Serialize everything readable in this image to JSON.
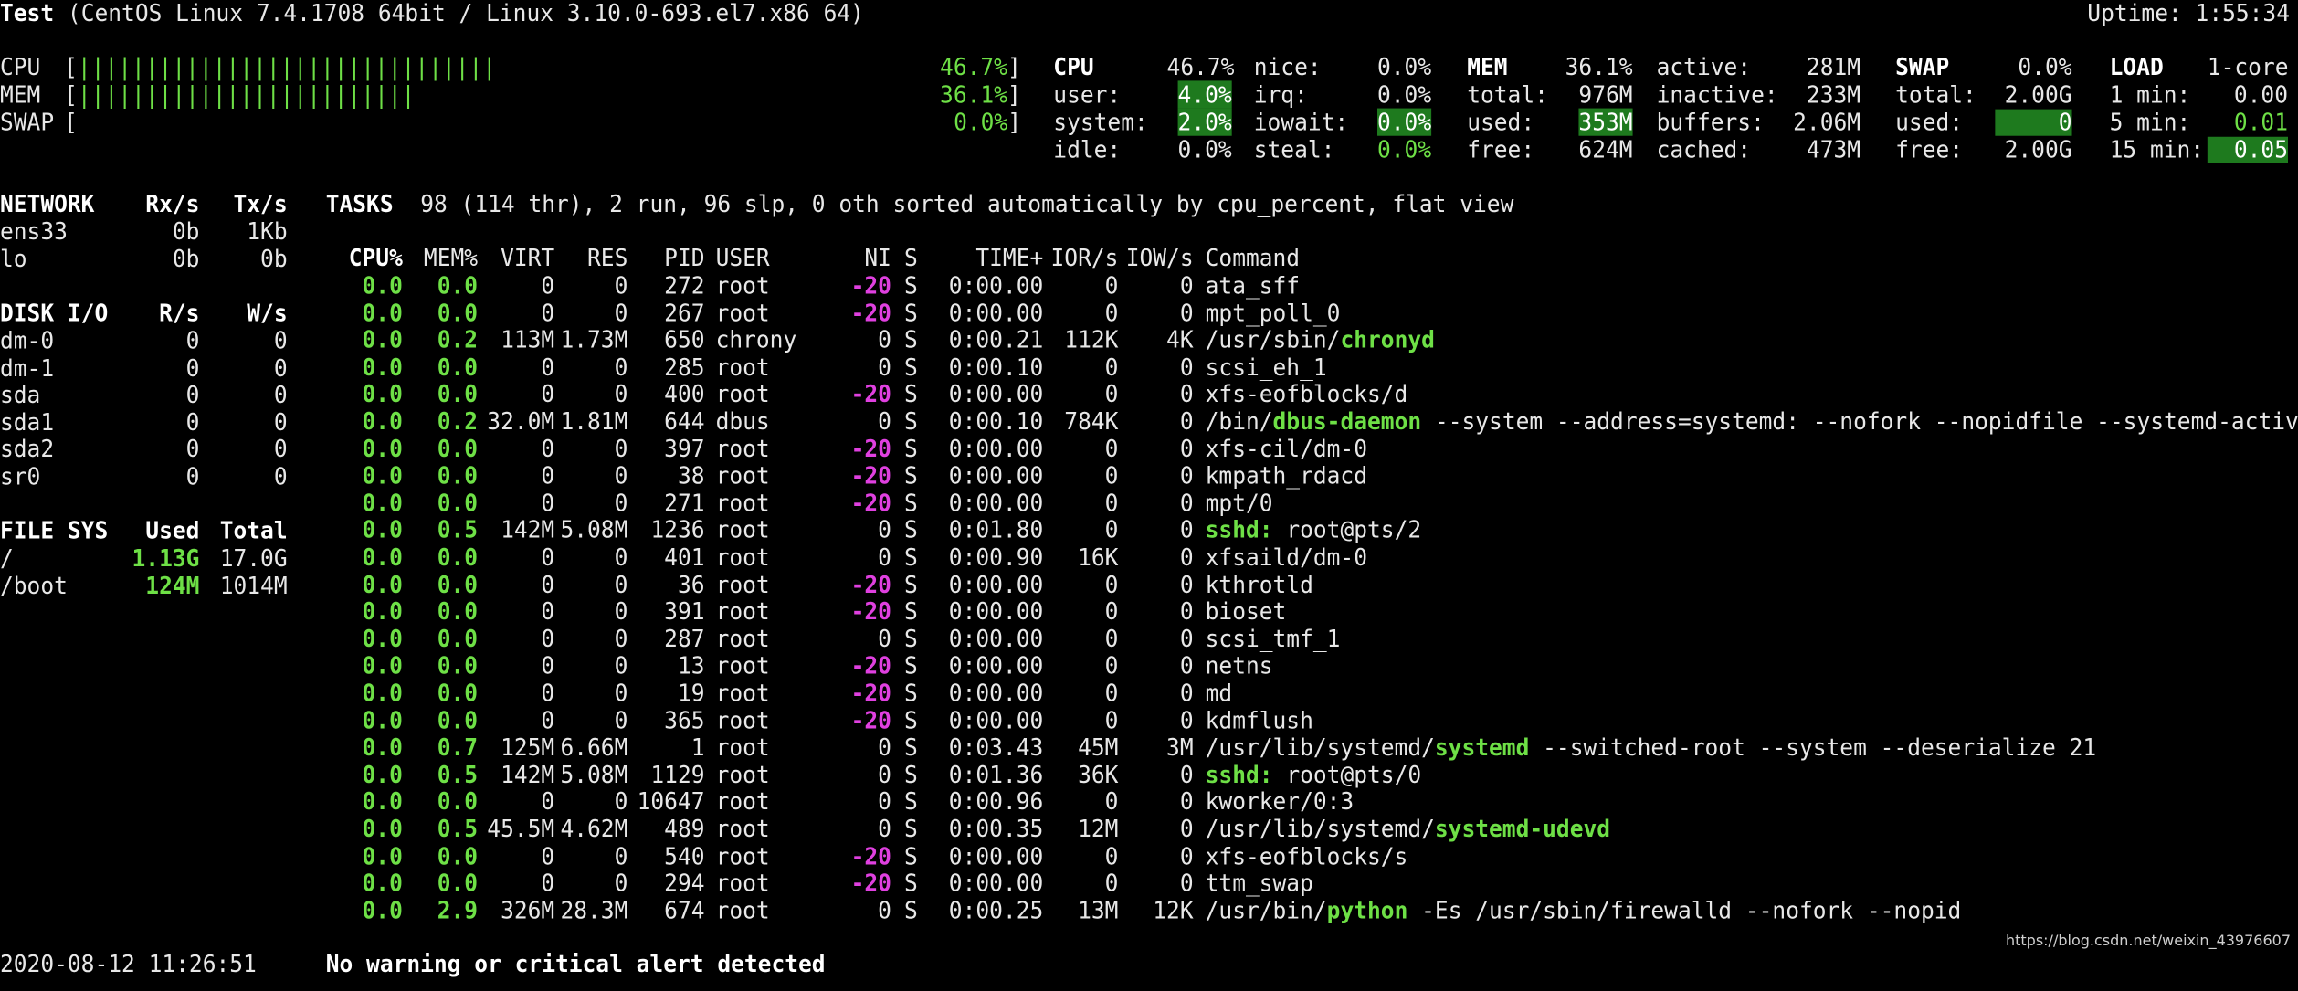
{
  "header": {
    "hostname": "Test",
    "system": "(CentOS Linux 7.4.1708 64bit / Linux 3.10.0-693.el7.x86_64)",
    "uptime": "Uptime: 1:55:34"
  },
  "quicklook": {
    "cpu": {
      "label": "CPU",
      "bar": "|||||||||||||||||||||||||||||||",
      "value": "46.7%"
    },
    "mem": {
      "label": "MEM",
      "bar": "|||||||||||||||||||||||||",
      "value": "36.1%"
    },
    "swap": {
      "label": "SWAP",
      "bar": "",
      "value": "0.0%"
    }
  },
  "cpu": {
    "title": "CPU",
    "total": "46.7%",
    "user_label": "user:",
    "user": "4.0%",
    "system_label": "system:",
    "system": "2.0%",
    "idle_label": "idle:",
    "idle": "0.0%",
    "nice_label": "nice:",
    "nice": "0.0%",
    "irq_label": "irq:",
    "irq": "0.0%",
    "iowait_label": "iowait:",
    "iowait": "0.0%",
    "steal_label": "steal:",
    "steal": "0.0%"
  },
  "mem": {
    "title": "MEM",
    "percent": "36.1%",
    "total_label": "total:",
    "total": "976M",
    "used_label": "used:",
    "used": "353M",
    "free_label": "free:",
    "free": "624M",
    "active_label": "active:",
    "active": "281M",
    "inactive_label": "inactive:",
    "inactive": "233M",
    "buffers_label": "buffers:",
    "buffers": "2.06M",
    "cached_label": "cached:",
    "cached": "473M"
  },
  "swap": {
    "title": "SWAP",
    "percent": "0.0%",
    "total_label": "total:",
    "total": "2.00G",
    "used_label": "used:",
    "used": "0",
    "free_label": "free:",
    "free": "2.00G"
  },
  "load": {
    "title": "LOAD",
    "cores": "1-core",
    "m1_label": "1 min:",
    "m1": "0.00",
    "m5_label": "5 min:",
    "m5": "0.01",
    "m15_label": "15 min:",
    "m15": "0.05"
  },
  "network": {
    "title": "NETWORK",
    "rx_header": "Rx/s",
    "tx_header": "Tx/s",
    "rows": [
      {
        "name": "ens33",
        "rx": "0b",
        "tx": "1Kb"
      },
      {
        "name": "lo",
        "rx": "0b",
        "tx": "0b"
      }
    ]
  },
  "diskio": {
    "title": "DISK I/O",
    "r_header": "R/s",
    "w_header": "W/s",
    "rows": [
      {
        "name": "dm-0",
        "r": "0",
        "w": "0"
      },
      {
        "name": "dm-1",
        "r": "0",
        "w": "0"
      },
      {
        "name": "sda",
        "r": "0",
        "w": "0"
      },
      {
        "name": "sda1",
        "r": "0",
        "w": "0"
      },
      {
        "name": "sda2",
        "r": "0",
        "w": "0"
      },
      {
        "name": "sr0",
        "r": "0",
        "w": "0"
      }
    ]
  },
  "filesys": {
    "title": "FILE SYS",
    "used_header": "Used",
    "total_header": "Total",
    "rows": [
      {
        "name": "/",
        "used": "1.13G",
        "total": "17.0G"
      },
      {
        "name": "/boot",
        "used": "124M",
        "total": "1014M"
      }
    ]
  },
  "tasks": {
    "title": "TASKS",
    "summary": "98 (114 thr), 2 run, 96 slp, 0 oth sorted automatically by cpu_percent, flat view"
  },
  "process_headers": {
    "cpu": "CPU%",
    "mem": "MEM%",
    "virt": "VIRT",
    "res": "RES",
    "pid": "PID",
    "user": "USER",
    "ni": "NI",
    "s": "S",
    "time": "TIME+",
    "ior": "IOR/s",
    "iow": "IOW/s",
    "cmd": "Command"
  },
  "processes": [
    {
      "cpu": "0.0",
      "mem": "0.0",
      "virt": "0",
      "res": "0",
      "pid": "272",
      "user": "root",
      "ni": "-20",
      "s": "S",
      "time": "0:00.00",
      "ior": "0",
      "iow": "0",
      "cmd_prefix": "",
      "cmd_main": "ata_sff",
      "cmd_args": "",
      "main_green": false
    },
    {
      "cpu": "0.0",
      "mem": "0.0",
      "virt": "0",
      "res": "0",
      "pid": "267",
      "user": "root",
      "ni": "-20",
      "s": "S",
      "time": "0:00.00",
      "ior": "0",
      "iow": "0",
      "cmd_prefix": "",
      "cmd_main": "mpt_poll_0",
      "cmd_args": "",
      "main_green": false
    },
    {
      "cpu": "0.0",
      "mem": "0.2",
      "virt": "113M",
      "res": "1.73M",
      "pid": "650",
      "user": "chrony",
      "ni": "0",
      "s": "S",
      "time": "0:00.21",
      "ior": "112K",
      "iow": "4K",
      "cmd_prefix": "/usr/sbin/",
      "cmd_main": "chronyd",
      "cmd_args": "",
      "main_green": true
    },
    {
      "cpu": "0.0",
      "mem": "0.0",
      "virt": "0",
      "res": "0",
      "pid": "285",
      "user": "root",
      "ni": "0",
      "s": "S",
      "time": "0:00.10",
      "ior": "0",
      "iow": "0",
      "cmd_prefix": "",
      "cmd_main": "scsi_eh_1",
      "cmd_args": "",
      "main_green": false
    },
    {
      "cpu": "0.0",
      "mem": "0.0",
      "virt": "0",
      "res": "0",
      "pid": "400",
      "user": "root",
      "ni": "-20",
      "s": "S",
      "time": "0:00.00",
      "ior": "0",
      "iow": "0",
      "cmd_prefix": "",
      "cmd_main": "xfs-eofblocks/d",
      "cmd_args": "",
      "main_green": false
    },
    {
      "cpu": "0.0",
      "mem": "0.2",
      "virt": "32.0M",
      "res": "1.81M",
      "pid": "644",
      "user": "dbus",
      "ni": "0",
      "s": "S",
      "time": "0:00.10",
      "ior": "784K",
      "iow": "0",
      "cmd_prefix": "/bin/",
      "cmd_main": "dbus-daemon",
      "cmd_args": " --system --address=systemd: --nofork --nopidfile --systemd-activation",
      "main_green": true
    },
    {
      "cpu": "0.0",
      "mem": "0.0",
      "virt": "0",
      "res": "0",
      "pid": "397",
      "user": "root",
      "ni": "-20",
      "s": "S",
      "time": "0:00.00",
      "ior": "0",
      "iow": "0",
      "cmd_prefix": "",
      "cmd_main": "xfs-cil/dm-0",
      "cmd_args": "",
      "main_green": false
    },
    {
      "cpu": "0.0",
      "mem": "0.0",
      "virt": "0",
      "res": "0",
      "pid": "38",
      "user": "root",
      "ni": "-20",
      "s": "S",
      "time": "0:00.00",
      "ior": "0",
      "iow": "0",
      "cmd_prefix": "",
      "cmd_main": "kmpath_rdacd",
      "cmd_args": "",
      "main_green": false
    },
    {
      "cpu": "0.0",
      "mem": "0.0",
      "virt": "0",
      "res": "0",
      "pid": "271",
      "user": "root",
      "ni": "-20",
      "s": "S",
      "time": "0:00.00",
      "ior": "0",
      "iow": "0",
      "cmd_prefix": "",
      "cmd_main": "mpt/0",
      "cmd_args": "",
      "main_green": false
    },
    {
      "cpu": "0.0",
      "mem": "0.5",
      "virt": "142M",
      "res": "5.08M",
      "pid": "1236",
      "user": "root",
      "ni": "0",
      "s": "S",
      "time": "0:01.80",
      "ior": "0",
      "iow": "0",
      "cmd_prefix": "",
      "cmd_main": "sshd:",
      "cmd_args": " root@pts/2",
      "main_green": true
    },
    {
      "cpu": "0.0",
      "mem": "0.0",
      "virt": "0",
      "res": "0",
      "pid": "401",
      "user": "root",
      "ni": "0",
      "s": "S",
      "time": "0:00.90",
      "ior": "16K",
      "iow": "0",
      "cmd_prefix": "",
      "cmd_main": "xfsaild/dm-0",
      "cmd_args": "",
      "main_green": false
    },
    {
      "cpu": "0.0",
      "mem": "0.0",
      "virt": "0",
      "res": "0",
      "pid": "36",
      "user": "root",
      "ni": "-20",
      "s": "S",
      "time": "0:00.00",
      "ior": "0",
      "iow": "0",
      "cmd_prefix": "",
      "cmd_main": "kthrotld",
      "cmd_args": "",
      "main_green": false
    },
    {
      "cpu": "0.0",
      "mem": "0.0",
      "virt": "0",
      "res": "0",
      "pid": "391",
      "user": "root",
      "ni": "-20",
      "s": "S",
      "time": "0:00.00",
      "ior": "0",
      "iow": "0",
      "cmd_prefix": "",
      "cmd_main": "bioset",
      "cmd_args": "",
      "main_green": false
    },
    {
      "cpu": "0.0",
      "mem": "0.0",
      "virt": "0",
      "res": "0",
      "pid": "287",
      "user": "root",
      "ni": "0",
      "s": "S",
      "time": "0:00.00",
      "ior": "0",
      "iow": "0",
      "cmd_prefix": "",
      "cmd_main": "scsi_tmf_1",
      "cmd_args": "",
      "main_green": false
    },
    {
      "cpu": "0.0",
      "mem": "0.0",
      "virt": "0",
      "res": "0",
      "pid": "13",
      "user": "root",
      "ni": "-20",
      "s": "S",
      "time": "0:00.00",
      "ior": "0",
      "iow": "0",
      "cmd_prefix": "",
      "cmd_main": "netns",
      "cmd_args": "",
      "main_green": false
    },
    {
      "cpu": "0.0",
      "mem": "0.0",
      "virt": "0",
      "res": "0",
      "pid": "19",
      "user": "root",
      "ni": "-20",
      "s": "S",
      "time": "0:00.00",
      "ior": "0",
      "iow": "0",
      "cmd_prefix": "",
      "cmd_main": "md",
      "cmd_args": "",
      "main_green": false
    },
    {
      "cpu": "0.0",
      "mem": "0.0",
      "virt": "0",
      "res": "0",
      "pid": "365",
      "user": "root",
      "ni": "-20",
      "s": "S",
      "time": "0:00.00",
      "ior": "0",
      "iow": "0",
      "cmd_prefix": "",
      "cmd_main": "kdmflush",
      "cmd_args": "",
      "main_green": false
    },
    {
      "cpu": "0.0",
      "mem": "0.7",
      "virt": "125M",
      "res": "6.66M",
      "pid": "1",
      "user": "root",
      "ni": "0",
      "s": "S",
      "time": "0:03.43",
      "ior": "45M",
      "iow": "3M",
      "cmd_prefix": "/usr/lib/systemd/",
      "cmd_main": "systemd",
      "cmd_args": " --switched-root --system --deserialize 21",
      "main_green": true
    },
    {
      "cpu": "0.0",
      "mem": "0.5",
      "virt": "142M",
      "res": "5.08M",
      "pid": "1129",
      "user": "root",
      "ni": "0",
      "s": "S",
      "time": "0:01.36",
      "ior": "36K",
      "iow": "0",
      "cmd_prefix": "",
      "cmd_main": "sshd:",
      "cmd_args": " root@pts/0",
      "main_green": true
    },
    {
      "cpu": "0.0",
      "mem": "0.0",
      "virt": "0",
      "res": "0",
      "pid": "10647",
      "user": "root",
      "ni": "0",
      "s": "S",
      "time": "0:00.96",
      "ior": "0",
      "iow": "0",
      "cmd_prefix": "",
      "cmd_main": "kworker/0:3",
      "cmd_args": "",
      "main_green": false
    },
    {
      "cpu": "0.0",
      "mem": "0.5",
      "virt": "45.5M",
      "res": "4.62M",
      "pid": "489",
      "user": "root",
      "ni": "0",
      "s": "S",
      "time": "0:00.35",
      "ior": "12M",
      "iow": "0",
      "cmd_prefix": "/usr/lib/systemd/",
      "cmd_main": "systemd-udevd",
      "cmd_args": "",
      "main_green": true
    },
    {
      "cpu": "0.0",
      "mem": "0.0",
      "virt": "0",
      "res": "0",
      "pid": "540",
      "user": "root",
      "ni": "-20",
      "s": "S",
      "time": "0:00.00",
      "ior": "0",
      "iow": "0",
      "cmd_prefix": "",
      "cmd_main": "xfs-eofblocks/s",
      "cmd_args": "",
      "main_green": false
    },
    {
      "cpu": "0.0",
      "mem": "0.0",
      "virt": "0",
      "res": "0",
      "pid": "294",
      "user": "root",
      "ni": "-20",
      "s": "S",
      "time": "0:00.00",
      "ior": "0",
      "iow": "0",
      "cmd_prefix": "",
      "cmd_main": "ttm_swap",
      "cmd_args": "",
      "main_green": false
    },
    {
      "cpu": "0.0",
      "mem": "2.9",
      "virt": "326M",
      "res": "28.3M",
      "pid": "674",
      "user": "root",
      "ni": "0",
      "s": "S",
      "time": "0:00.25",
      "ior": "13M",
      "iow": "12K",
      "cmd_prefix": "/usr/bin/",
      "cmd_main": "python",
      "cmd_args": " -Es /usr/sbin/firewalld --nofork --nopid",
      "main_green": true
    }
  ],
  "footer": {
    "timestamp": "2020-08-12 11:26:51",
    "alert": "No warning or critical alert detected"
  },
  "watermark": "https://blog.csdn.net/weixin_43976607",
  "colors": {
    "background": "#000000",
    "text": "#e8e8e8",
    "green": "#6ee046",
    "magenta": "#e040e0",
    "highlight": "#1e7a1e"
  }
}
